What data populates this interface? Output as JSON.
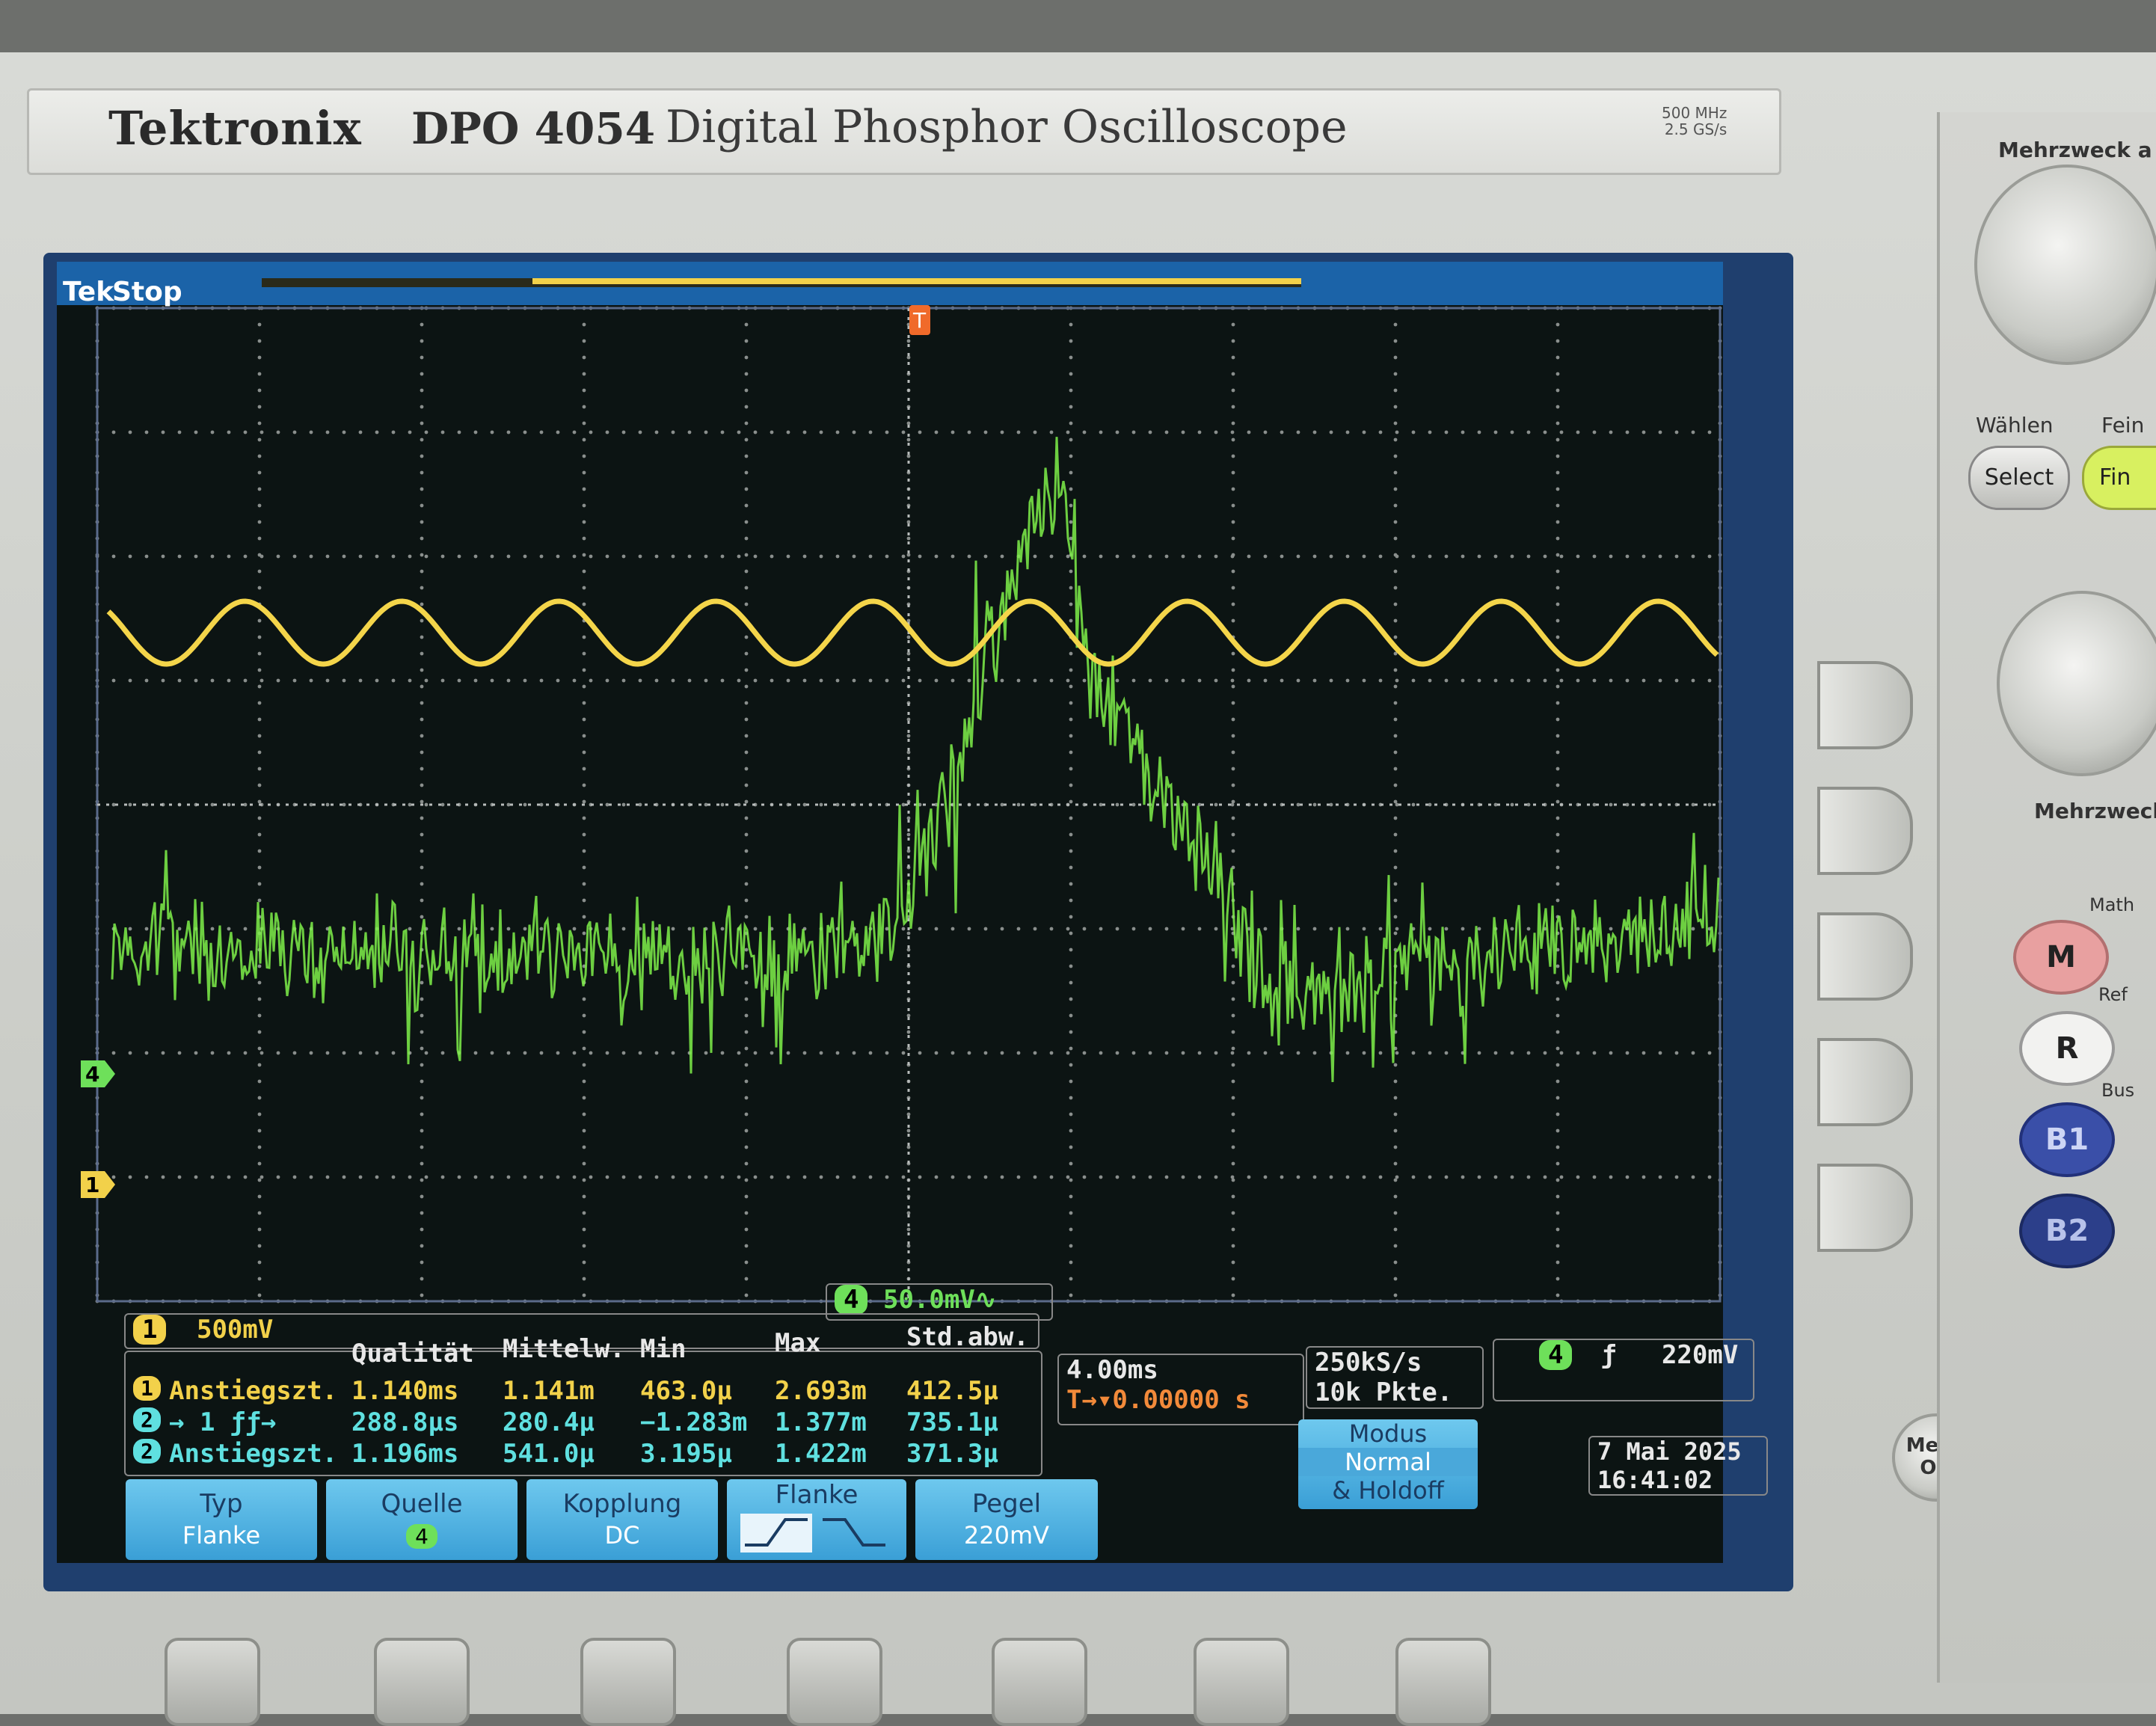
{
  "front_panel": {
    "brand": "Tektronix",
    "model": "DPO 4054",
    "model_name": "Digital Phosphor Oscilloscope",
    "specs_bandwidth": "500 MHz",
    "specs_rate": "2.5 GS/s",
    "knob_top_label": "Mehrzweck a",
    "knob_mid_label": "Mehrzweck",
    "waehlen_label": "Wählen",
    "fein_label": "Fein",
    "select_button": "Select",
    "fine_button": "Fin",
    "math_label": "Math",
    "ref_label": "Ref",
    "bus_label": "Bus",
    "btn_m": "M",
    "btn_r": "R",
    "btn_b1": "B1",
    "btn_b2": "B2",
    "menu_off_line1": "Menu",
    "menu_off_line2": "Off"
  },
  "status": {
    "tek": "Tek",
    "run_state": "Stop"
  },
  "channels": {
    "ch1": {
      "num": "1",
      "scale": "500mV",
      "color": "#f2d14a"
    },
    "ch4": {
      "num": "4",
      "scale": "50.0mV",
      "bw_symbol": "∿",
      "color": "#6ee05a"
    },
    "ch2": {
      "num": "2"
    }
  },
  "measurements": {
    "headers": [
      "Qualität",
      "Mittelw.",
      "Min",
      "Max",
      "Std.abw."
    ],
    "rows": [
      {
        "ch": "1",
        "label": "Anstiegszt.",
        "values": [
          "1.140ms",
          "1.141m",
          "463.0µ",
          "2.693m",
          "412.5µ"
        ],
        "color": "y"
      },
      {
        "ch": "2",
        "label": "→ 1 ƒƒ→",
        "values": [
          "288.8µs",
          "280.4µ",
          "−1.283m",
          "1.377m",
          "735.1µ"
        ],
        "color": "c"
      },
      {
        "ch": "2",
        "label": "Anstiegszt.",
        "values": [
          "1.196ms",
          "541.0µ",
          "3.195µ",
          "1.422m",
          "371.3µ"
        ],
        "color": "c"
      }
    ]
  },
  "horizontal": {
    "scale": "4.00ms",
    "delay": "0.00000 s"
  },
  "acquisition": {
    "rate": "250kS/s",
    "points": "10k Pkte."
  },
  "trigger": {
    "source": "4",
    "slope": "ƒ",
    "level": "220mV",
    "marker": "T"
  },
  "mode": {
    "title": "Modus",
    "value": "Normal",
    "extra": "& Holdoff"
  },
  "datetime": {
    "date": "7 Mai  2025",
    "time": "16:41:02"
  },
  "softkeys": [
    {
      "label": "Typ",
      "value": "Flanke"
    },
    {
      "label": "Quelle",
      "value": "4"
    },
    {
      "label": "Kopplung",
      "value": "DC"
    },
    {
      "label": "Flanke",
      "value": ""
    },
    {
      "label": "Pegel",
      "value": "220mV"
    }
  ]
}
